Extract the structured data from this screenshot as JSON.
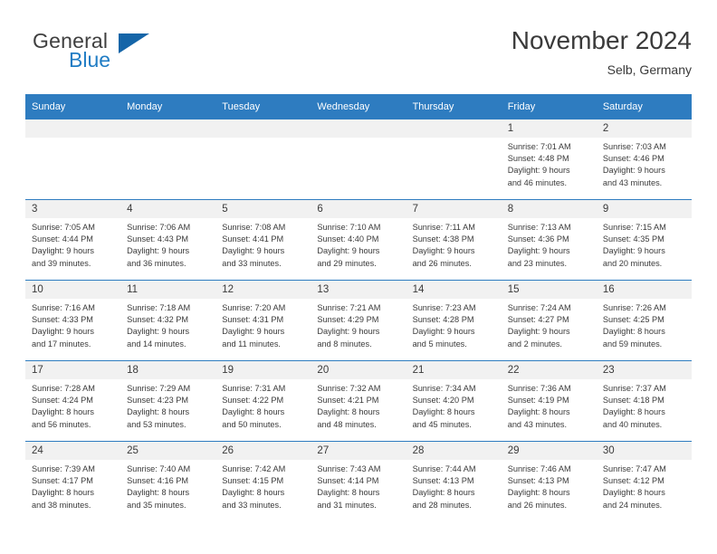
{
  "brand": {
    "name_part1": "General",
    "name_part2": "Blue",
    "triangle_icon": "triangle-icon",
    "accent_color": "#1f7cc4"
  },
  "header": {
    "title": "November 2024",
    "subtitle": "Selb, Germany"
  },
  "theme": {
    "header_blue": "#2e7cc0",
    "daynum_bg": "#f1f1f1",
    "text": "#3a3a3a"
  },
  "weekday_headers": [
    "Sunday",
    "Monday",
    "Tuesday",
    "Wednesday",
    "Thursday",
    "Friday",
    "Saturday"
  ],
  "weeks": [
    [
      {
        "day": "",
        "sunrise": "",
        "sunset": "",
        "daylight_line1": "",
        "daylight_line2": ""
      },
      {
        "day": "",
        "sunrise": "",
        "sunset": "",
        "daylight_line1": "",
        "daylight_line2": ""
      },
      {
        "day": "",
        "sunrise": "",
        "sunset": "",
        "daylight_line1": "",
        "daylight_line2": ""
      },
      {
        "day": "",
        "sunrise": "",
        "sunset": "",
        "daylight_line1": "",
        "daylight_line2": ""
      },
      {
        "day": "",
        "sunrise": "",
        "sunset": "",
        "daylight_line1": "",
        "daylight_line2": ""
      },
      {
        "day": "1",
        "sunrise": "Sunrise: 7:01 AM",
        "sunset": "Sunset: 4:48 PM",
        "daylight_line1": "Daylight: 9 hours",
        "daylight_line2": "and 46 minutes."
      },
      {
        "day": "2",
        "sunrise": "Sunrise: 7:03 AM",
        "sunset": "Sunset: 4:46 PM",
        "daylight_line1": "Daylight: 9 hours",
        "daylight_line2": "and 43 minutes."
      }
    ],
    [
      {
        "day": "3",
        "sunrise": "Sunrise: 7:05 AM",
        "sunset": "Sunset: 4:44 PM",
        "daylight_line1": "Daylight: 9 hours",
        "daylight_line2": "and 39 minutes."
      },
      {
        "day": "4",
        "sunrise": "Sunrise: 7:06 AM",
        "sunset": "Sunset: 4:43 PM",
        "daylight_line1": "Daylight: 9 hours",
        "daylight_line2": "and 36 minutes."
      },
      {
        "day": "5",
        "sunrise": "Sunrise: 7:08 AM",
        "sunset": "Sunset: 4:41 PM",
        "daylight_line1": "Daylight: 9 hours",
        "daylight_line2": "and 33 minutes."
      },
      {
        "day": "6",
        "sunrise": "Sunrise: 7:10 AM",
        "sunset": "Sunset: 4:40 PM",
        "daylight_line1": "Daylight: 9 hours",
        "daylight_line2": "and 29 minutes."
      },
      {
        "day": "7",
        "sunrise": "Sunrise: 7:11 AM",
        "sunset": "Sunset: 4:38 PM",
        "daylight_line1": "Daylight: 9 hours",
        "daylight_line2": "and 26 minutes."
      },
      {
        "day": "8",
        "sunrise": "Sunrise: 7:13 AM",
        "sunset": "Sunset: 4:36 PM",
        "daylight_line1": "Daylight: 9 hours",
        "daylight_line2": "and 23 minutes."
      },
      {
        "day": "9",
        "sunrise": "Sunrise: 7:15 AM",
        "sunset": "Sunset: 4:35 PM",
        "daylight_line1": "Daylight: 9 hours",
        "daylight_line2": "and 20 minutes."
      }
    ],
    [
      {
        "day": "10",
        "sunrise": "Sunrise: 7:16 AM",
        "sunset": "Sunset: 4:33 PM",
        "daylight_line1": "Daylight: 9 hours",
        "daylight_line2": "and 17 minutes."
      },
      {
        "day": "11",
        "sunrise": "Sunrise: 7:18 AM",
        "sunset": "Sunset: 4:32 PM",
        "daylight_line1": "Daylight: 9 hours",
        "daylight_line2": "and 14 minutes."
      },
      {
        "day": "12",
        "sunrise": "Sunrise: 7:20 AM",
        "sunset": "Sunset: 4:31 PM",
        "daylight_line1": "Daylight: 9 hours",
        "daylight_line2": "and 11 minutes."
      },
      {
        "day": "13",
        "sunrise": "Sunrise: 7:21 AM",
        "sunset": "Sunset: 4:29 PM",
        "daylight_line1": "Daylight: 9 hours",
        "daylight_line2": "and 8 minutes."
      },
      {
        "day": "14",
        "sunrise": "Sunrise: 7:23 AM",
        "sunset": "Sunset: 4:28 PM",
        "daylight_line1": "Daylight: 9 hours",
        "daylight_line2": "and 5 minutes."
      },
      {
        "day": "15",
        "sunrise": "Sunrise: 7:24 AM",
        "sunset": "Sunset: 4:27 PM",
        "daylight_line1": "Daylight: 9 hours",
        "daylight_line2": "and 2 minutes."
      },
      {
        "day": "16",
        "sunrise": "Sunrise: 7:26 AM",
        "sunset": "Sunset: 4:25 PM",
        "daylight_line1": "Daylight: 8 hours",
        "daylight_line2": "and 59 minutes."
      }
    ],
    [
      {
        "day": "17",
        "sunrise": "Sunrise: 7:28 AM",
        "sunset": "Sunset: 4:24 PM",
        "daylight_line1": "Daylight: 8 hours",
        "daylight_line2": "and 56 minutes."
      },
      {
        "day": "18",
        "sunrise": "Sunrise: 7:29 AM",
        "sunset": "Sunset: 4:23 PM",
        "daylight_line1": "Daylight: 8 hours",
        "daylight_line2": "and 53 minutes."
      },
      {
        "day": "19",
        "sunrise": "Sunrise: 7:31 AM",
        "sunset": "Sunset: 4:22 PM",
        "daylight_line1": "Daylight: 8 hours",
        "daylight_line2": "and 50 minutes."
      },
      {
        "day": "20",
        "sunrise": "Sunrise: 7:32 AM",
        "sunset": "Sunset: 4:21 PM",
        "daylight_line1": "Daylight: 8 hours",
        "daylight_line2": "and 48 minutes."
      },
      {
        "day": "21",
        "sunrise": "Sunrise: 7:34 AM",
        "sunset": "Sunset: 4:20 PM",
        "daylight_line1": "Daylight: 8 hours",
        "daylight_line2": "and 45 minutes."
      },
      {
        "day": "22",
        "sunrise": "Sunrise: 7:36 AM",
        "sunset": "Sunset: 4:19 PM",
        "daylight_line1": "Daylight: 8 hours",
        "daylight_line2": "and 43 minutes."
      },
      {
        "day": "23",
        "sunrise": "Sunrise: 7:37 AM",
        "sunset": "Sunset: 4:18 PM",
        "daylight_line1": "Daylight: 8 hours",
        "daylight_line2": "and 40 minutes."
      }
    ],
    [
      {
        "day": "24",
        "sunrise": "Sunrise: 7:39 AM",
        "sunset": "Sunset: 4:17 PM",
        "daylight_line1": "Daylight: 8 hours",
        "daylight_line2": "and 38 minutes."
      },
      {
        "day": "25",
        "sunrise": "Sunrise: 7:40 AM",
        "sunset": "Sunset: 4:16 PM",
        "daylight_line1": "Daylight: 8 hours",
        "daylight_line2": "and 35 minutes."
      },
      {
        "day": "26",
        "sunrise": "Sunrise: 7:42 AM",
        "sunset": "Sunset: 4:15 PM",
        "daylight_line1": "Daylight: 8 hours",
        "daylight_line2": "and 33 minutes."
      },
      {
        "day": "27",
        "sunrise": "Sunrise: 7:43 AM",
        "sunset": "Sunset: 4:14 PM",
        "daylight_line1": "Daylight: 8 hours",
        "daylight_line2": "and 31 minutes."
      },
      {
        "day": "28",
        "sunrise": "Sunrise: 7:44 AM",
        "sunset": "Sunset: 4:13 PM",
        "daylight_line1": "Daylight: 8 hours",
        "daylight_line2": "and 28 minutes."
      },
      {
        "day": "29",
        "sunrise": "Sunrise: 7:46 AM",
        "sunset": "Sunset: 4:13 PM",
        "daylight_line1": "Daylight: 8 hours",
        "daylight_line2": "and 26 minutes."
      },
      {
        "day": "30",
        "sunrise": "Sunrise: 7:47 AM",
        "sunset": "Sunset: 4:12 PM",
        "daylight_line1": "Daylight: 8 hours",
        "daylight_line2": "and 24 minutes."
      }
    ]
  ]
}
